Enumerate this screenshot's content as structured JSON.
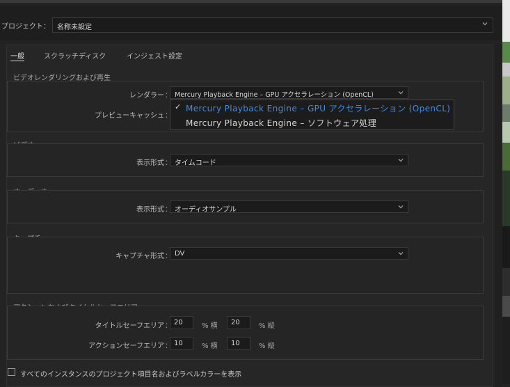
{
  "project": {
    "label": "プロジェクト：",
    "value": "名称未設定"
  },
  "tabs": [
    {
      "label": "一般"
    },
    {
      "label": "スクラッチディスク"
    },
    {
      "label": "インジェスト設定"
    }
  ],
  "sections": {
    "video_render": {
      "title": "ビデオレンダリングおよび再生",
      "renderer_label": "レンダラー",
      "renderer_value": "Mercury Playback Engine – GPU アクセラレーション (OpenCL)",
      "preview_cache_label": "プレビューキャッシュ"
    },
    "video": {
      "title": "ビデオ",
      "display_format_label": "表示形式",
      "display_format_value": "タイムコード"
    },
    "audio": {
      "title": "オーディオ",
      "display_format_label": "表示形式",
      "display_format_value": "オーディオサンプル"
    },
    "capture": {
      "title": "キャプチャ",
      "format_label": "キャプチャ形式",
      "format_value": "DV"
    },
    "safe_area": {
      "title": "アクションおよびタイトルセーフエリア",
      "title_safe_label": "タイトルセーフエリア",
      "title_h": "20",
      "title_v": "20",
      "action_safe_label": "アクションセーフエリア",
      "action_h": "10",
      "action_v": "10",
      "unit_h": "% 横",
      "unit_v": "% 縦"
    }
  },
  "colon": "：",
  "renderer_popup": {
    "options": [
      {
        "label": "Mercury Playback Engine – GPU アクセラレーション (OpenCL)",
        "selected": true
      },
      {
        "label": "Mercury Playback Engine – ソフトウェア処理",
        "selected": false
      }
    ],
    "check_mark": "✓"
  },
  "footer": {
    "checkbox_label": "すべてのインスタンスのプロジェクト項目名およびラベルカラーを表示"
  },
  "colors": {
    "accent": "#3d8ce8",
    "background": "#232323"
  }
}
